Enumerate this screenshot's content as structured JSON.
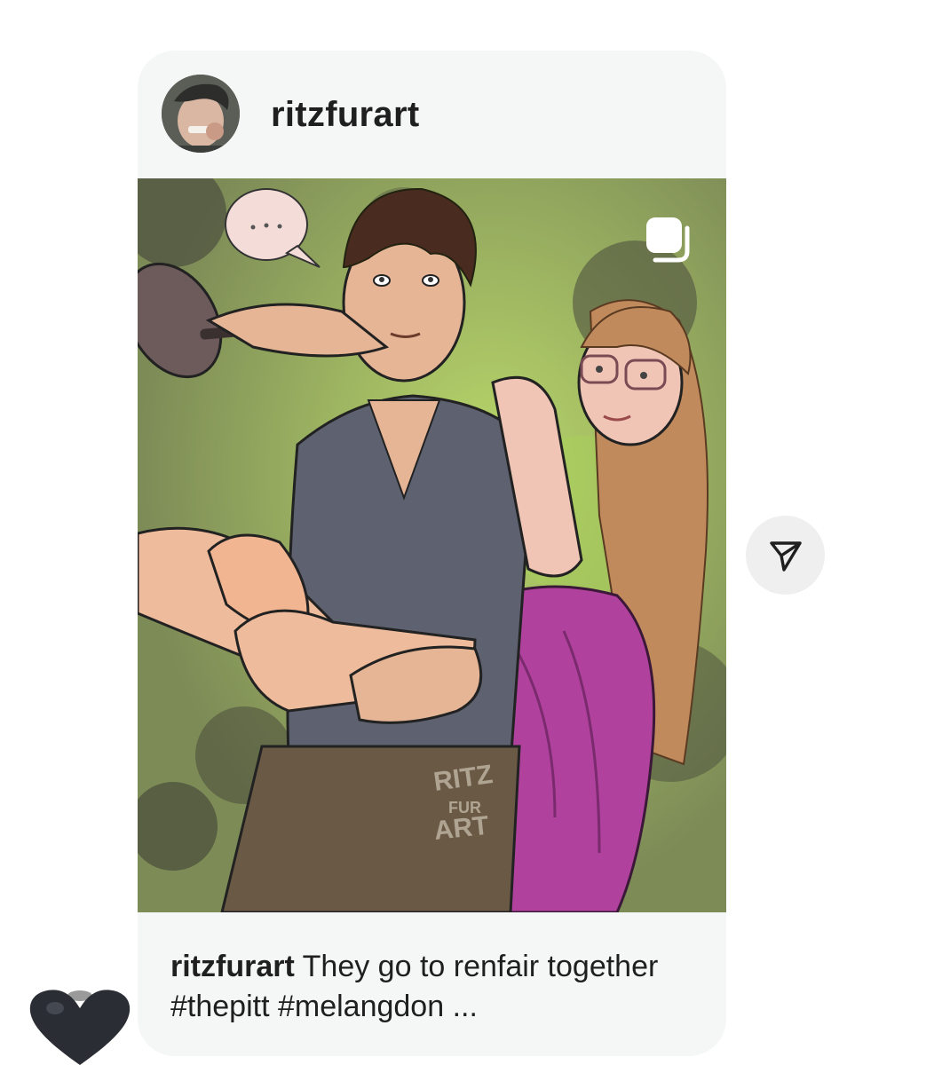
{
  "post": {
    "username": "ritzfurart",
    "caption_user": "ritzfurart",
    "caption_text": "They go to renfair together #thepitt #melangdon ...",
    "image": {
      "description_icon": "multiple-images-icon",
      "watermark": "RITZ FUR ART"
    }
  },
  "actions": {
    "share_icon": "send-icon"
  },
  "reaction": {
    "icon": "heart-icon",
    "color": "#2a2d33"
  },
  "colors": {
    "card_bg": "#f5f6f6",
    "text": "#1f1f1f",
    "share_bg": "#efefef"
  }
}
